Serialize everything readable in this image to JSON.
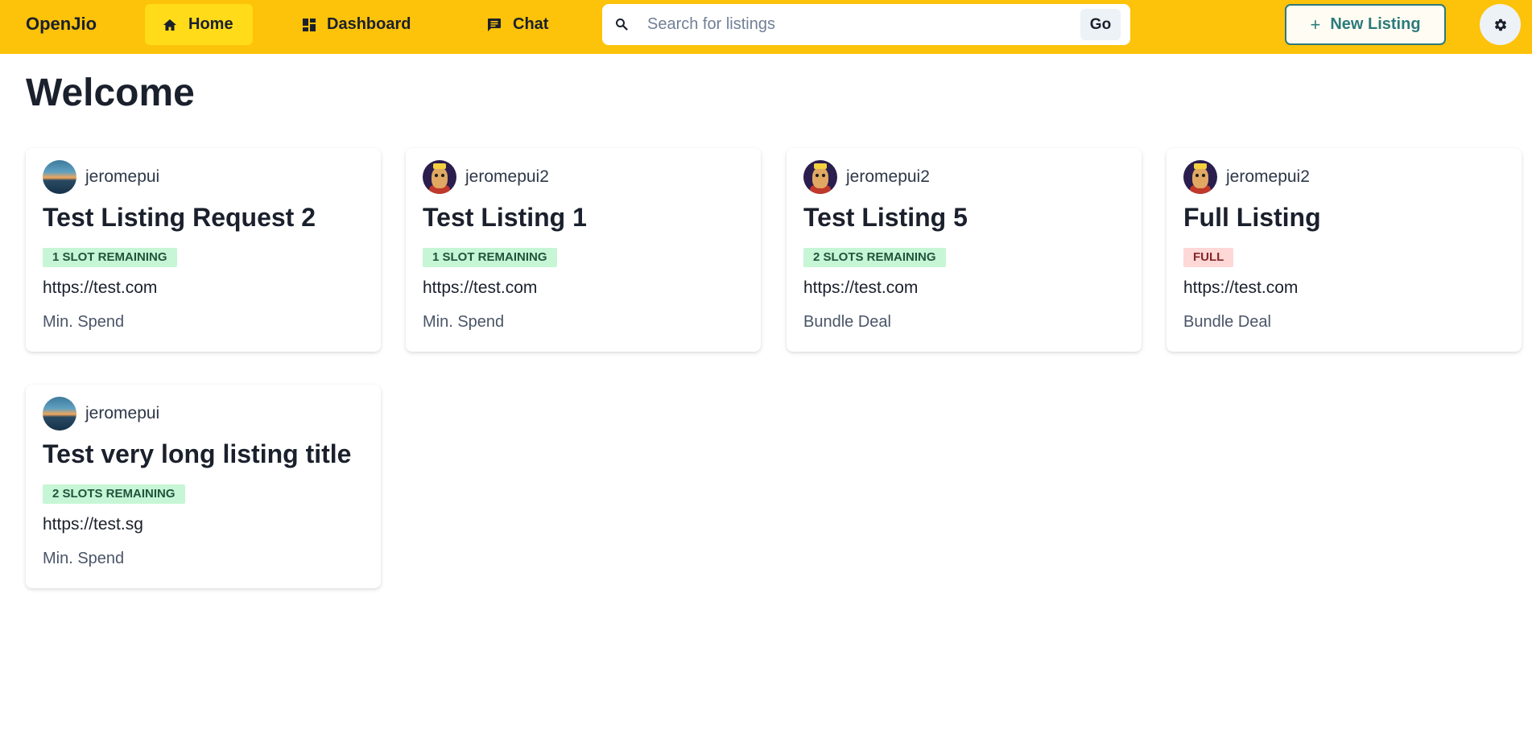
{
  "navbar": {
    "brand": "OpenJio",
    "links": [
      {
        "label": "Home",
        "icon": "home-icon",
        "active": true
      },
      {
        "label": "Dashboard",
        "icon": "dashboard-icon",
        "active": false
      },
      {
        "label": "Chat",
        "icon": "chat-icon",
        "active": false
      }
    ],
    "search": {
      "placeholder": "Search for listings",
      "value": "",
      "button_label": "Go"
    },
    "new_listing_label": "New Listing",
    "settings_icon": "gear-icon"
  },
  "colors": {
    "navbar_bg": "#fdc20a",
    "active_link_bg": "#ffdb19",
    "accent": "#2c7a7b",
    "badge_green_bg": "#c6f6d5",
    "badge_green_text": "#22543d",
    "badge_red_bg": "#fed7d7",
    "badge_red_text": "#822727"
  },
  "page": {
    "title": "Welcome"
  },
  "listings": [
    {
      "owner": "jeromepui",
      "avatar": "landscape",
      "title": "Test Listing Request 2",
      "badge": "1 SLOT REMAINING",
      "badge_color": "green",
      "url": "https://test.com",
      "type": "Min. Spend"
    },
    {
      "owner": "jeromepui2",
      "avatar": "mascot",
      "title": "Test Listing 1",
      "badge": "1 SLOT REMAINING",
      "badge_color": "green",
      "url": "https://test.com",
      "type": "Min. Spend"
    },
    {
      "owner": "jeromepui2",
      "avatar": "mascot",
      "title": "Test Listing 5",
      "badge": "2 SLOTS REMAINING",
      "badge_color": "green",
      "url": "https://test.com",
      "type": "Bundle Deal"
    },
    {
      "owner": "jeromepui2",
      "avatar": "mascot",
      "title": "Full Listing",
      "badge": "FULL",
      "badge_color": "red",
      "url": "https://test.com",
      "type": "Bundle Deal"
    },
    {
      "owner": "jeromepui",
      "avatar": "landscape",
      "title": "Test very long listing title",
      "badge": "2 SLOTS REMAINING",
      "badge_color": "green",
      "url": "https://test.sg",
      "type": "Min. Spend"
    }
  ]
}
